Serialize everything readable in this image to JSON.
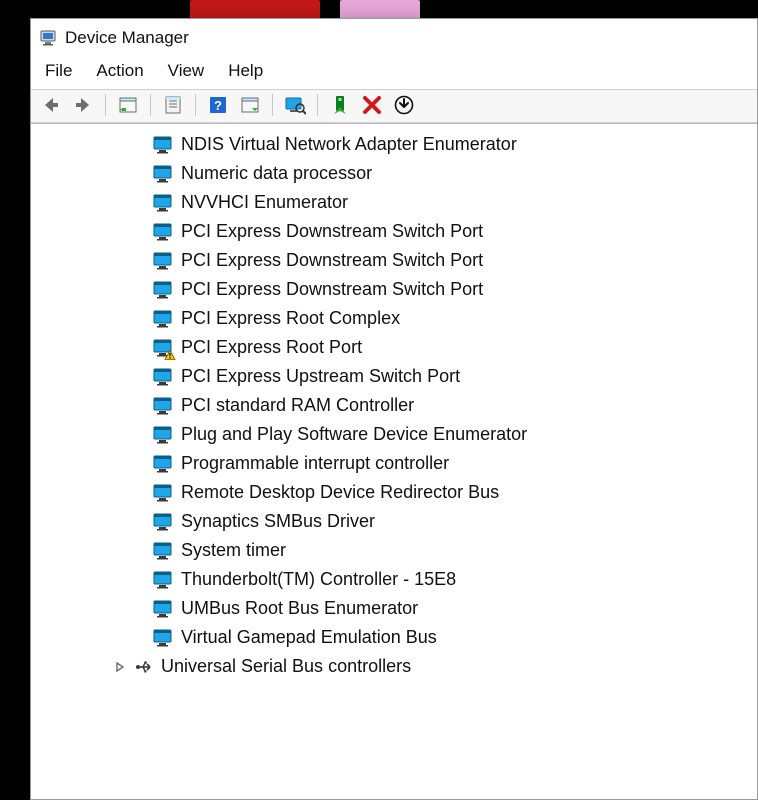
{
  "window": {
    "title": "Device Manager"
  },
  "menu": {
    "file": "File",
    "action": "Action",
    "view": "View",
    "help": "Help"
  },
  "devices": [
    {
      "label": "NDIS Virtual Network Adapter Enumerator",
      "warning": false
    },
    {
      "label": "Numeric data processor",
      "warning": false
    },
    {
      "label": "NVVHCI Enumerator",
      "warning": false
    },
    {
      "label": "PCI Express Downstream Switch Port",
      "warning": false
    },
    {
      "label": "PCI Express Downstream Switch Port",
      "warning": false
    },
    {
      "label": "PCI Express Downstream Switch Port",
      "warning": false
    },
    {
      "label": "PCI Express Root Complex",
      "warning": false
    },
    {
      "label": "PCI Express Root Port",
      "warning": true
    },
    {
      "label": "PCI Express Upstream Switch Port",
      "warning": false
    },
    {
      "label": "PCI standard RAM Controller",
      "warning": false
    },
    {
      "label": "Plug and Play Software Device Enumerator",
      "warning": false
    },
    {
      "label": "Programmable interrupt controller",
      "warning": false
    },
    {
      "label": "Remote Desktop Device Redirector Bus",
      "warning": false
    },
    {
      "label": "Synaptics SMBus Driver",
      "warning": false
    },
    {
      "label": "System timer",
      "warning": false
    },
    {
      "label": "Thunderbolt(TM) Controller - 15E8",
      "warning": false
    },
    {
      "label": "UMBus Root Bus Enumerator",
      "warning": false
    },
    {
      "label": "Virtual Gamepad Emulation Bus",
      "warning": false
    }
  ],
  "category": {
    "label": "Universal Serial Bus controllers"
  }
}
